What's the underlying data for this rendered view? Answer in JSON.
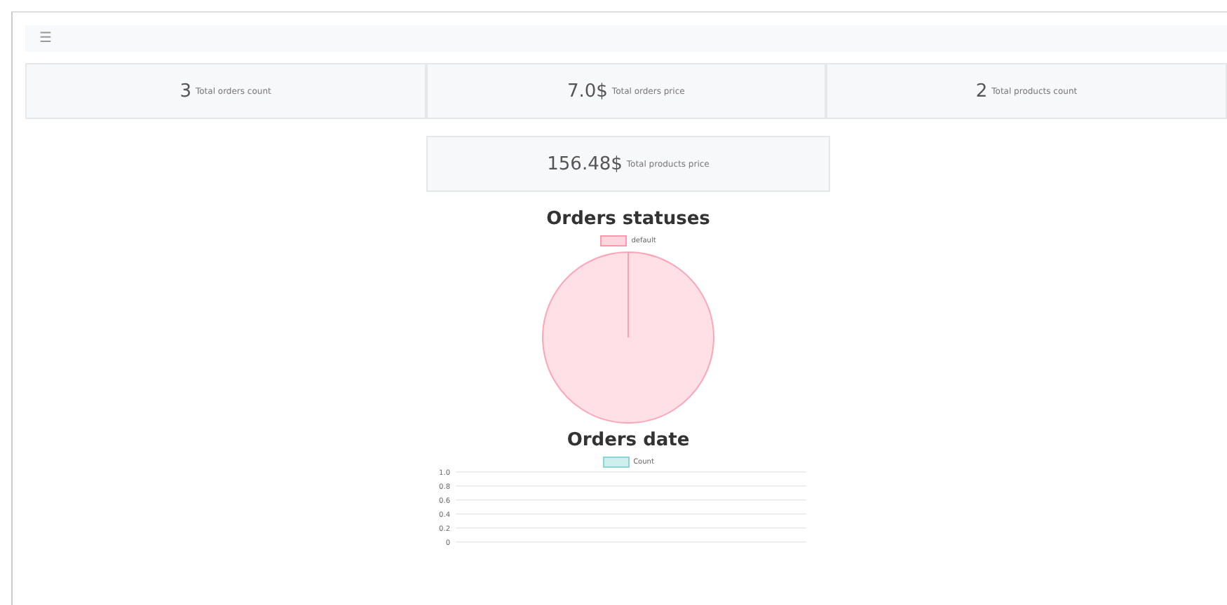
{
  "navbar": {
    "menu_icon": "☰"
  },
  "stats": [
    {
      "value": "3",
      "label": "Total orders count"
    },
    {
      "value": "7.0$",
      "label": "Total orders price"
    },
    {
      "value": "2",
      "label": "Total products count"
    },
    {
      "value": "156.48$",
      "label": "Total products price"
    }
  ],
  "charts": [
    {
      "title": "Orders statuses",
      "chart_data": {
        "type": "pie",
        "categories": [
          "default"
        ],
        "series": [
          {
            "color": "#ff6384",
            "values": [
              100
            ]
          }
        ]
      }
    },
    {
      "title": "Orders date",
      "chart_data": {
        "type": "line",
        "yticks": [
          0,
          0.2,
          0.4,
          0.6,
          0.8,
          {
            "value": 1,
            "label": "1.0"
          }
        ],
        "ylim": [
          0,
          1
        ],
        "grid": true,
        "series": [
          {
            "name": "Count",
            "color": "#4bc0c0"
          }
        ]
      }
    }
  ]
}
